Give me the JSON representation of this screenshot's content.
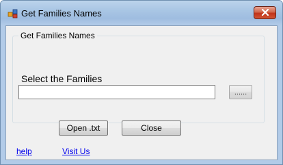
{
  "window": {
    "title": "Get Families Names",
    "app_icon": "families-app-icon",
    "close_icon": "close-icon"
  },
  "form": {
    "group_title": "Get Families Names",
    "select_label": "Select the Families",
    "path_input": {
      "value": "",
      "placeholder": ""
    },
    "browse_label": "......",
    "open_label": "Open .txt",
    "close_label": "Close"
  },
  "links": {
    "help": "help",
    "visit": "Visit Us"
  },
  "colors": {
    "title_bar": "#a9c6e4",
    "close_button": "#c1331a",
    "link": "#0000ee",
    "client_bg": "#f0f0f0"
  }
}
